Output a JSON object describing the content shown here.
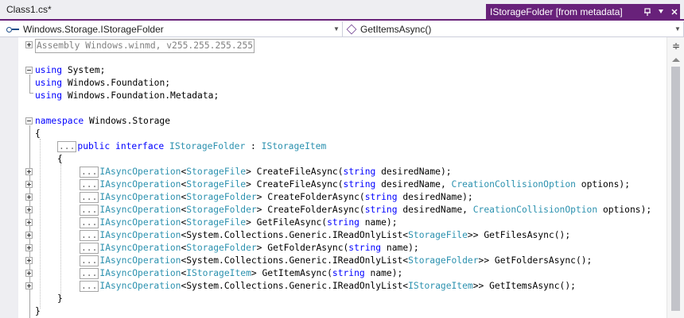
{
  "tabs": {
    "document_tab": "Class1.cs*",
    "metadata_tab": "IStorageFolder [from metadata]"
  },
  "navigation": {
    "type_selector": "Windows.Storage.IStorageFolder",
    "member_selector": "GetItemsAsync()"
  },
  "code": {
    "assembly_region": "Assembly Windows.winmd, v255.255.255.255",
    "using_lines": [
      "System;",
      "Windows.Foundation;",
      "Windows.Foundation.Metadata;"
    ],
    "using_keyword": "using",
    "namespace_keyword": "namespace",
    "namespace_name": " Windows.Storage",
    "open_brace": "{",
    "close_brace": "}",
    "collapsed_marker": "...",
    "interface_modifiers": "public interface ",
    "interface_name": "IStorageFolder",
    "interface_sep": " : ",
    "base_interface": "IStorageItem",
    "members": [
      [
        [
          "t",
          "IAsyncOperation"
        ],
        [
          "p",
          "<"
        ],
        [
          "t",
          "StorageFile"
        ],
        [
          "p",
          "> CreateFileAsync("
        ],
        [
          "k",
          "string"
        ],
        [
          "p",
          " desiredName);"
        ]
      ],
      [
        [
          "t",
          "IAsyncOperation"
        ],
        [
          "p",
          "<"
        ],
        [
          "t",
          "StorageFile"
        ],
        [
          "p",
          "> CreateFileAsync("
        ],
        [
          "k",
          "string"
        ],
        [
          "p",
          " desiredName, "
        ],
        [
          "t",
          "CreationCollisionOption"
        ],
        [
          "p",
          " options);"
        ]
      ],
      [
        [
          "t",
          "IAsyncOperation"
        ],
        [
          "p",
          "<"
        ],
        [
          "t",
          "StorageFolder"
        ],
        [
          "p",
          "> CreateFolderAsync("
        ],
        [
          "k",
          "string"
        ],
        [
          "p",
          " desiredName);"
        ]
      ],
      [
        [
          "t",
          "IAsyncOperation"
        ],
        [
          "p",
          "<"
        ],
        [
          "t",
          "StorageFolder"
        ],
        [
          "p",
          "> CreateFolderAsync("
        ],
        [
          "k",
          "string"
        ],
        [
          "p",
          " desiredName, "
        ],
        [
          "t",
          "CreationCollisionOption"
        ],
        [
          "p",
          " options);"
        ]
      ],
      [
        [
          "t",
          "IAsyncOperation"
        ],
        [
          "p",
          "<"
        ],
        [
          "t",
          "StorageFile"
        ],
        [
          "p",
          "> GetFileAsync("
        ],
        [
          "k",
          "string"
        ],
        [
          "p",
          " name);"
        ]
      ],
      [
        [
          "t",
          "IAsyncOperation"
        ],
        [
          "p",
          "<System.Collections.Generic.IReadOnlyList<"
        ],
        [
          "t",
          "StorageFile"
        ],
        [
          "p",
          ">> GetFilesAsync();"
        ]
      ],
      [
        [
          "t",
          "IAsyncOperation"
        ],
        [
          "p",
          "<"
        ],
        [
          "t",
          "StorageFolder"
        ],
        [
          "p",
          "> GetFolderAsync("
        ],
        [
          "k",
          "string"
        ],
        [
          "p",
          " name);"
        ]
      ],
      [
        [
          "t",
          "IAsyncOperation"
        ],
        [
          "p",
          "<System.Collections.Generic.IReadOnlyList<"
        ],
        [
          "t",
          "StorageFolder"
        ],
        [
          "p",
          ">> GetFoldersAsync();"
        ]
      ],
      [
        [
          "t",
          "IAsyncOperation"
        ],
        [
          "p",
          "<"
        ],
        [
          "t",
          "IStorageItem"
        ],
        [
          "p",
          "> GetItemAsync("
        ],
        [
          "k",
          "string"
        ],
        [
          "p",
          " name);"
        ]
      ],
      [
        [
          "t",
          "IAsyncOperation"
        ],
        [
          "p",
          "<System.Collections.Generic.IReadOnlyList<"
        ],
        [
          "t",
          "IStorageItem"
        ],
        [
          "p",
          ">> GetItemsAsync();"
        ]
      ]
    ]
  },
  "colors": {
    "accent": "#68217a",
    "keyword": "#0000ff",
    "type": "#2b91af",
    "comment_gray": "#808080"
  },
  "icons": {
    "namespace": "namespace-icon",
    "method": "method-icon",
    "pin": "pin-icon",
    "float": "float-icon",
    "close": "close-icon",
    "splitter": "splitter-icon"
  }
}
